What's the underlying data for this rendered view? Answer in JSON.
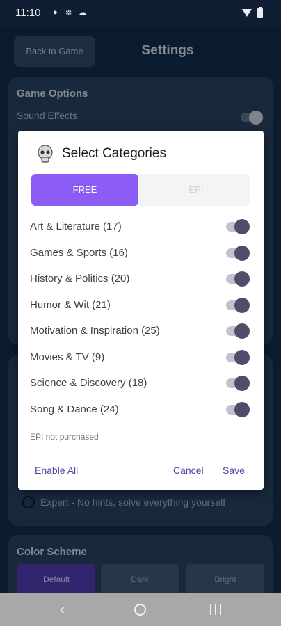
{
  "status_bar": {
    "time": "11:10",
    "icons": [
      "notification-icon",
      "settings-dot-icon",
      "cloud-icon",
      "wifi-icon",
      "battery-icon"
    ]
  },
  "header": {
    "back_button": "Back to Game",
    "title": "Settings"
  },
  "game_options": {
    "title": "Game Options",
    "sound_effects_label": "Sound Effects",
    "sound_effects_on": true
  },
  "difficulty": {
    "expert_label": "Expert - No hints, solve everything yourself",
    "expert_selected": false
  },
  "color_scheme": {
    "title": "Color Scheme",
    "options": [
      "Default",
      "Dark",
      "Bright"
    ],
    "selected": "Default"
  },
  "dialog": {
    "title": "Select Categories",
    "tabs": [
      {
        "label": "FREE",
        "active": true
      },
      {
        "label": "EPI",
        "active": false
      }
    ],
    "categories": [
      {
        "label": "Art & Literature (17)",
        "enabled": true
      },
      {
        "label": "Games & Sports (16)",
        "enabled": true
      },
      {
        "label": "History & Politics (20)",
        "enabled": true
      },
      {
        "label": "Humor & Wit (21)",
        "enabled": true
      },
      {
        "label": "Motivation & Inspiration (25)",
        "enabled": true
      },
      {
        "label": "Movies & TV (9)",
        "enabled": true
      },
      {
        "label": "Science & Discovery (18)",
        "enabled": true
      },
      {
        "label": "Song & Dance (24)",
        "enabled": true
      }
    ],
    "note": "EPI not purchased",
    "enable_all": "Enable All",
    "cancel": "Cancel",
    "save": "Save"
  },
  "colors": {
    "accent_purple": "#8c5cf6",
    "toggle_thumb": "#524b69",
    "action_text": "#4a47a8",
    "page_background": "#132b4a"
  },
  "nav_bar": {
    "icons": [
      "back-icon",
      "home-icon",
      "recents-icon"
    ]
  }
}
